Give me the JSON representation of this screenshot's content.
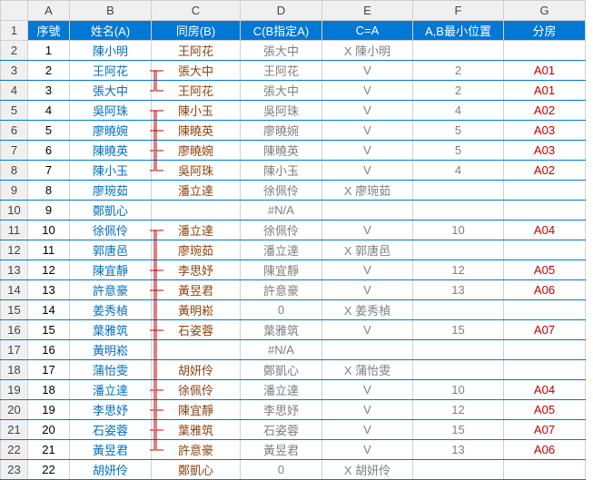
{
  "colHeaders": [
    "A",
    "B",
    "C",
    "D",
    "E",
    "F",
    "G"
  ],
  "rowHeaders": [
    "1",
    "2",
    "3",
    "4",
    "5",
    "6",
    "7",
    "8",
    "9",
    "10",
    "11",
    "12",
    "13",
    "14",
    "15",
    "16",
    "17",
    "18",
    "19",
    "20",
    "21",
    "22",
    "23"
  ],
  "headerRow": {
    "A": "序號",
    "B": "姓名(A)",
    "C": "同房(B)",
    "D": "C(B指定A)",
    "E": "C=A",
    "F": "A,B最小位置",
    "G": "分房"
  },
  "chart_data": {
    "type": "table",
    "title": "",
    "columns": [
      "序號",
      "姓名(A)",
      "同房(B)",
      "C(B指定A)",
      "C=A",
      "A,B最小位置",
      "分房"
    ],
    "rows": [
      {
        "A": "1",
        "B": "陳小明",
        "C": "王阿花",
        "D": "張大中",
        "E": "X 陳小明",
        "F": "",
        "G": ""
      },
      {
        "A": "2",
        "B": "王阿花",
        "C": "張大中",
        "D": "王阿花",
        "E": "V",
        "F": "2",
        "G": "A01"
      },
      {
        "A": "3",
        "B": "張大中",
        "C": "王阿花",
        "D": "張大中",
        "E": "V",
        "F": "2",
        "G": "A01"
      },
      {
        "A": "4",
        "B": "吳阿珠",
        "C": "陳小玉",
        "D": "吳阿珠",
        "E": "V",
        "F": "4",
        "G": "A02"
      },
      {
        "A": "5",
        "B": "廖曉婉",
        "C": "陳曉英",
        "D": "廖曉婉",
        "E": "V",
        "F": "5",
        "G": "A03"
      },
      {
        "A": "6",
        "B": "陳曉英",
        "C": "廖曉婉",
        "D": "陳曉英",
        "E": "V",
        "F": "5",
        "G": "A03"
      },
      {
        "A": "7",
        "B": "陳小玉",
        "C": "吳阿珠",
        "D": "陳小玉",
        "E": "V",
        "F": "4",
        "G": "A02"
      },
      {
        "A": "8",
        "B": "廖琬茹",
        "C": "潘立達",
        "D": "徐佩伶",
        "E": "X 廖琬茹",
        "F": "",
        "G": ""
      },
      {
        "A": "9",
        "B": "鄭凱心",
        "C": "",
        "D": "#N/A",
        "E": "",
        "F": "",
        "G": ""
      },
      {
        "A": "10",
        "B": "徐佩伶",
        "C": "潘立達",
        "D": "徐佩伶",
        "E": "V",
        "F": "10",
        "G": "A04"
      },
      {
        "A": "11",
        "B": "郭唐邑",
        "C": "廖琬茹",
        "D": "潘立達",
        "E": "X 郭唐邑",
        "F": "",
        "G": ""
      },
      {
        "A": "12",
        "B": "陳宜靜",
        "C": "李思妤",
        "D": "陳宜靜",
        "E": "V",
        "F": "12",
        "G": "A05"
      },
      {
        "A": "13",
        "B": "許意豪",
        "C": "黃昱君",
        "D": "許意豪",
        "E": "V",
        "F": "13",
        "G": "A06"
      },
      {
        "A": "14",
        "B": "姜秀楨",
        "C": "黃明崧",
        "D": "0",
        "E": "X 姜秀楨",
        "F": "",
        "G": ""
      },
      {
        "A": "15",
        "B": "葉雅筑",
        "C": "石姿蓉",
        "D": "葉雅筑",
        "E": "V",
        "F": "15",
        "G": "A07"
      },
      {
        "A": "16",
        "B": "黃明崧",
        "C": "",
        "D": "#N/A",
        "E": "",
        "F": "",
        "G": ""
      },
      {
        "A": "17",
        "B": "蒲怡雯",
        "C": "胡妍伶",
        "D": "鄭凱心",
        "E": "X 蒲怡雯",
        "F": "",
        "G": ""
      },
      {
        "A": "18",
        "B": "潘立達",
        "C": "徐佩伶",
        "D": "潘立達",
        "E": "V",
        "F": "10",
        "G": "A04"
      },
      {
        "A": "19",
        "B": "李思妤",
        "C": "陳宜靜",
        "D": "李思妤",
        "E": "V",
        "F": "12",
        "G": "A05"
      },
      {
        "A": "20",
        "B": "石姿蓉",
        "C": "葉雅筑",
        "D": "石姿蓉",
        "E": "V",
        "F": "15",
        "G": "A07"
      },
      {
        "A": "21",
        "B": "黃昱君",
        "C": "許意豪",
        "D": "黃昱君",
        "E": "V",
        "F": "13",
        "G": "A06"
      },
      {
        "A": "22",
        "B": "胡妍伶",
        "C": "鄭凱心",
        "D": "0",
        "E": "X 胡妍伶",
        "F": "",
        "G": ""
      }
    ]
  }
}
